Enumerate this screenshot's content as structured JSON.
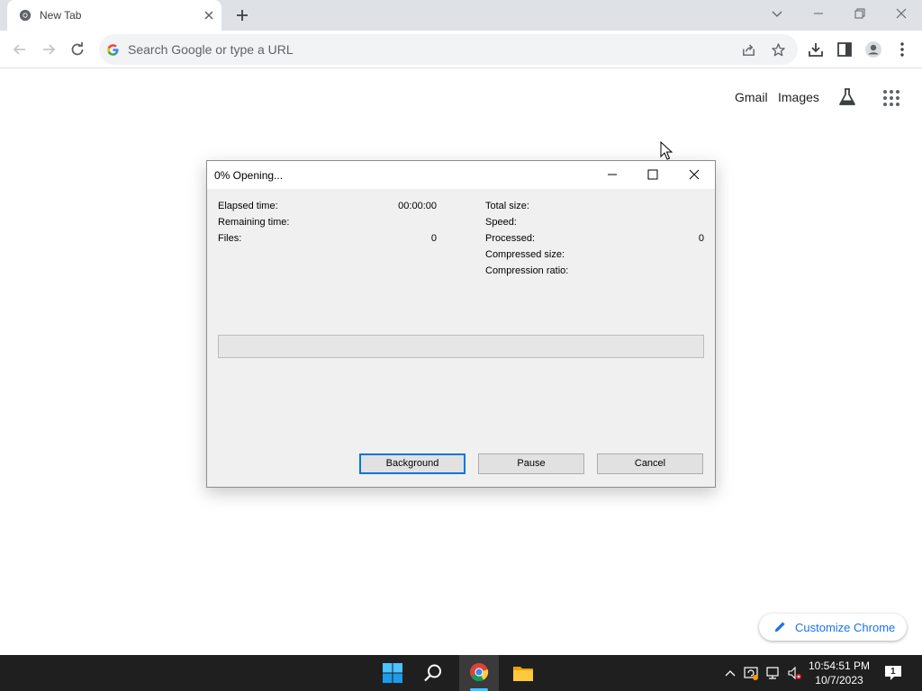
{
  "browser": {
    "tab": {
      "title": "New Tab"
    },
    "omnibox": {
      "placeholder": "Search Google or type a URL"
    }
  },
  "ntp": {
    "links": {
      "gmail": "Gmail",
      "images": "Images"
    },
    "customize_label": "Customize Chrome"
  },
  "dialog": {
    "title": "0% Opening...",
    "stats_left": [
      {
        "label": "Elapsed time:",
        "value": "00:00:00"
      },
      {
        "label": "Remaining time:",
        "value": ""
      },
      {
        "label": "Files:",
        "value": "0"
      }
    ],
    "stats_right": [
      {
        "label": "Total size:",
        "value": ""
      },
      {
        "label": "Speed:",
        "value": ""
      },
      {
        "label": "Processed:",
        "value": "0"
      },
      {
        "label": "Compressed size:",
        "value": ""
      },
      {
        "label": "Compression ratio:",
        "value": ""
      }
    ],
    "progress_fraction": 0,
    "buttons": {
      "background": "Background",
      "pause": "Pause",
      "cancel": "Cancel"
    }
  },
  "taskbar": {
    "clock": {
      "time": "10:54:51 PM",
      "date": "10/7/2023"
    },
    "notification_count": "1",
    "apps": [
      "start-icon",
      "search-icon",
      "chrome-icon",
      "file-explorer-icon"
    ]
  },
  "colors": {
    "tabstrip": "#dee1e6",
    "dialog_bg": "#f0f0f0",
    "taskbar": "#1f1f1f",
    "link_blue": "#1a73e8",
    "default_button_border": "#0078d7"
  }
}
